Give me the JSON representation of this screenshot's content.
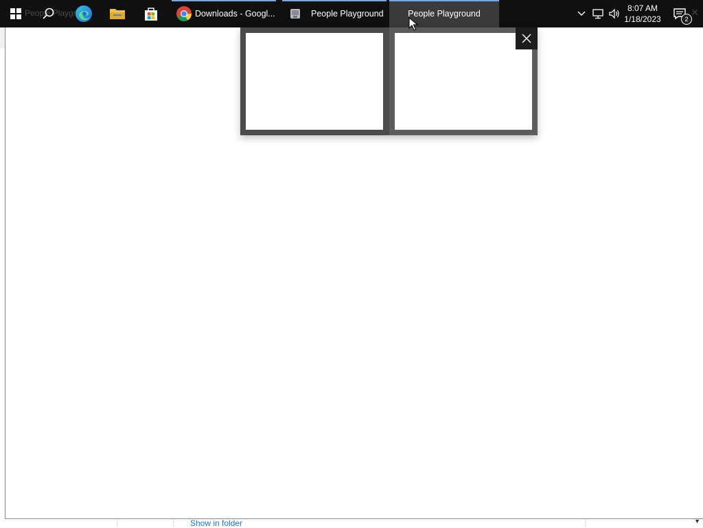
{
  "taskbar": {
    "ghost_window_title": "People Playgro",
    "tasks": [
      {
        "label": "Downloads - Googl...",
        "icon": "chrome-icon"
      },
      {
        "label": "People Playground",
        "icon": "people-playground-icon"
      },
      {
        "label": "People Playground",
        "icon": "people-playground-icon"
      }
    ],
    "pinned": [
      "edge-icon",
      "file-explorer-icon",
      "store-icon"
    ],
    "clock": {
      "time": "8:07 AM",
      "date": "1/18/2023"
    },
    "notification_count": "2"
  },
  "download_bar": {
    "show_in_folder": "Show in folder"
  },
  "preview": {
    "thumbnail_count": 2
  },
  "colors": {
    "taskbar_bg": "#101010",
    "active_task_bg": "#3a3a3a",
    "preview_bg": "#4b4b4b",
    "accent": "#76a9e6",
    "link": "#1a73e8"
  }
}
